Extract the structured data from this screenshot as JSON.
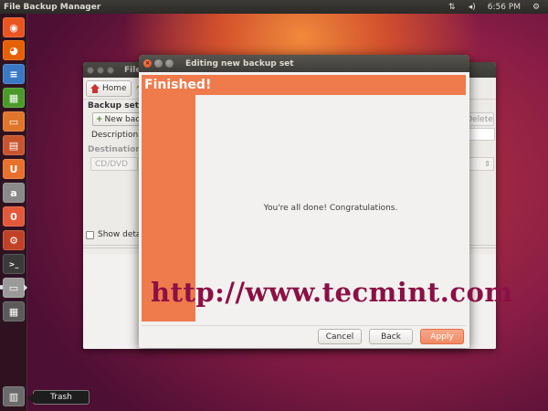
{
  "top_panel": {
    "app_title": "File Backup Manager",
    "indicators": {
      "network_icon": "network-arrows-icon",
      "volume_icon": "speaker-icon",
      "clock": "6:56 PM",
      "power_icon": "gear-icon"
    }
  },
  "launcher": {
    "items": [
      {
        "name": "dash-home",
        "icon": "ubuntu-logo-icon",
        "color": "#e95420",
        "glyph": "◉"
      },
      {
        "name": "firefox",
        "icon": "firefox-icon",
        "color": "#e66000",
        "glyph": "◕"
      },
      {
        "name": "writer",
        "icon": "libreoffice-writer-icon",
        "color": "#3b78c3",
        "glyph": "≡"
      },
      {
        "name": "calc",
        "icon": "libreoffice-calc-icon",
        "color": "#4a9a2a",
        "glyph": "▦"
      },
      {
        "name": "impress",
        "icon": "libreoffice-impress-icon",
        "color": "#e0762a",
        "glyph": "▭"
      },
      {
        "name": "software-center",
        "icon": "software-center-icon",
        "color": "#c8542e",
        "glyph": "▤"
      },
      {
        "name": "ubuntu-one",
        "icon": "ubuntu-one-icon",
        "color": "#e8712d",
        "glyph": "U"
      },
      {
        "name": "amazon",
        "icon": "amazon-icon",
        "color": "#8a8a8a",
        "glyph": "a"
      },
      {
        "name": "ubuntu-one-music",
        "icon": "ubuntu-one-music-icon",
        "color": "#e2583a",
        "glyph": "0"
      },
      {
        "name": "system-settings",
        "icon": "settings-gear-icon",
        "color": "#c04226",
        "glyph": "⚙"
      },
      {
        "name": "terminal",
        "icon": "terminal-icon",
        "color": "#3a3a3a",
        "glyph": ">_"
      },
      {
        "name": "backup-manager",
        "icon": "backup-drive-icon",
        "color": "#9a9a9a",
        "glyph": "▭"
      },
      {
        "name": "workspace-switcher",
        "icon": "workspaces-icon",
        "color": "#5a5a5a",
        "glyph": "▦"
      }
    ],
    "trash_icon": "trash-icon",
    "trash_tooltip": "Trash"
  },
  "background_window": {
    "title": "File",
    "home_label": "Home",
    "backup_set_heading": "Backup set",
    "new_backup_label": "New backup",
    "delete_label": "Delete",
    "description_label": "Description:",
    "destination_heading": "Destination",
    "destination_value": "CD/DVD",
    "show_details_label": "Show details"
  },
  "dialog": {
    "title": "Editing new backup set",
    "banner": "Finished!",
    "message": "You're all done! Congratulations.",
    "cancel_label": "Cancel",
    "back_label": "Back",
    "apply_label": "Apply"
  },
  "watermark": "http://www.tecmint.com",
  "colors": {
    "accent": "#ef7a4b",
    "watermark": "#8b1044",
    "panel": "#3c3b37"
  }
}
